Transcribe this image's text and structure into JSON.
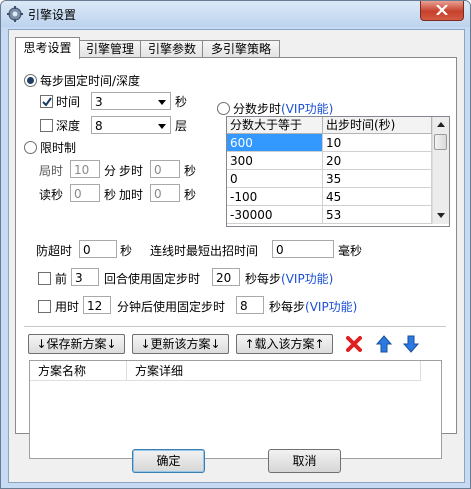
{
  "window": {
    "title": "引擎设置"
  },
  "tabs": [
    {
      "label": "思考设置",
      "active": true
    },
    {
      "label": "引擎管理",
      "active": false
    },
    {
      "label": "引擎参数",
      "active": false
    },
    {
      "label": "多引擎策略",
      "active": false
    }
  ],
  "think": {
    "fixed_per_move_label": "每步固定时间/深度",
    "time_label": "时间",
    "time_value": "3",
    "time_unit": "秒",
    "depth_label": "深度",
    "depth_value": "8",
    "depth_unit": "层",
    "time_limit_label": "限时制",
    "game_time_label": "局时",
    "game_time_value": "10",
    "minute_label": "分",
    "step_time_label": "步时",
    "step_time_value": "0",
    "second_label": "秒",
    "byoyomi_label": "读秒",
    "byoyomi_value": "0",
    "second_label2": "秒",
    "increment_label": "加时",
    "increment_value": "0",
    "second_label3": "秒"
  },
  "score_step": {
    "label": "分数步时",
    "vip": "(VIP功能)",
    "columns": [
      "分数大于等于",
      "出步时间(秒)"
    ],
    "rows": [
      [
        "600",
        "10"
      ],
      [
        "300",
        "20"
      ],
      [
        "0",
        "35"
      ],
      [
        "-100",
        "45"
      ],
      [
        "-30000",
        "53"
      ]
    ]
  },
  "timeout": {
    "label": "防超时",
    "value": "0",
    "unit": "秒",
    "min_time_label": "连线时最短出招时间",
    "min_time_value": "0",
    "min_time_unit": "毫秒"
  },
  "front_rounds": {
    "prefix": "前",
    "value": "3",
    "text": "回合使用固定步时",
    "seconds_value": "20",
    "suffix": "秒每步",
    "vip": "(VIP功能)"
  },
  "elapsed": {
    "prefix": "用时",
    "value": "12",
    "text": "分钟后使用固定步时",
    "seconds_value": "8",
    "suffix": "秒每步",
    "vip": "(VIP功能)"
  },
  "toolbar": {
    "save_new": "↓保存新方案↓",
    "update": "↓更新该方案↓",
    "load": "↑载入该方案↑"
  },
  "schemes": {
    "columns": [
      "方案名称",
      "方案详细"
    ]
  },
  "buttons": {
    "ok": "确定",
    "cancel": "取消"
  },
  "icons": {
    "app": "gear-icon",
    "close": "close-icon",
    "delete": "red-x-icon",
    "up": "arrow-up-icon",
    "down": "arrow-down-icon"
  },
  "colors": {
    "vip": "#1a4fd6",
    "selection": "#3399ff",
    "delete": "#e02020",
    "arrow": "#2a7ae2"
  }
}
